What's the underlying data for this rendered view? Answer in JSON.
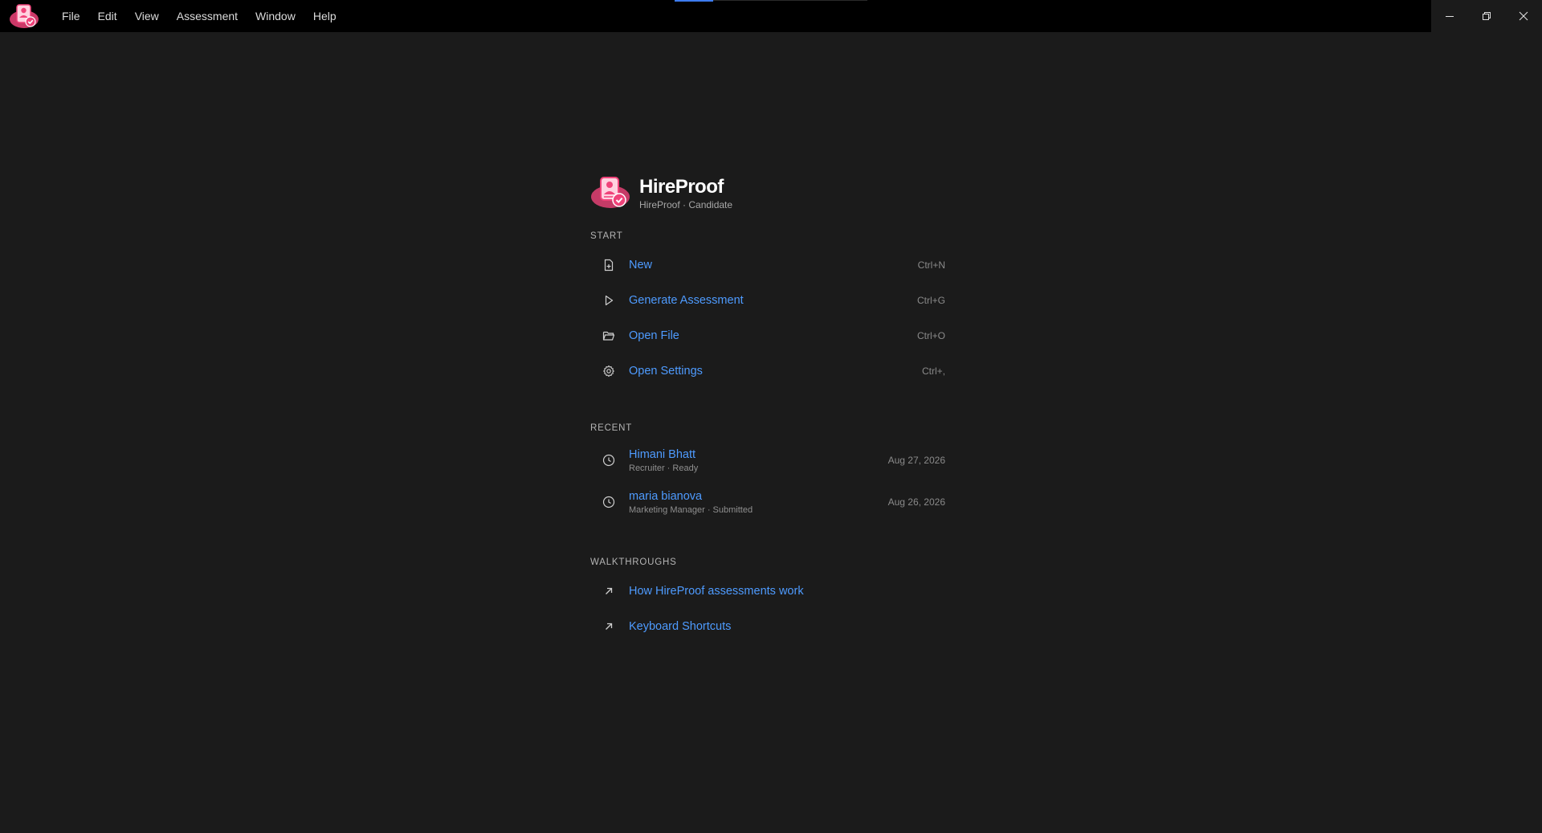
{
  "menubar": {
    "items": [
      "File",
      "Edit",
      "View",
      "Assessment",
      "Window",
      "Help"
    ]
  },
  "brand": {
    "title": "HireProof",
    "subtitle": "HireProof · Candidate",
    "accent": "#f0437a"
  },
  "start": {
    "heading": "START",
    "items": [
      {
        "label": "New",
        "shortcut": "Ctrl+N",
        "icon": "new-file-icon"
      },
      {
        "label": "Generate Assessment",
        "shortcut": "Ctrl+G",
        "icon": "play-icon"
      },
      {
        "label": "Open File",
        "shortcut": "Ctrl+O",
        "icon": "folder-open-icon"
      },
      {
        "label": "Open Settings",
        "shortcut": "Ctrl+,",
        "icon": "gear-icon"
      }
    ]
  },
  "recent": {
    "heading": "RECENT",
    "items": [
      {
        "name": "Himani Bhatt",
        "meta": "Recruiter · Ready",
        "date": "Aug 27, 2026",
        "icon": "clock-icon"
      },
      {
        "name": "maria bianova",
        "meta": "Marketing Manager · Submitted",
        "date": "Aug 26, 2026",
        "icon": "clock-icon"
      }
    ]
  },
  "walkthroughs": {
    "heading": "WALKTHROUGHS",
    "items": [
      {
        "label": "How HireProof assessments work",
        "icon": "arrow-up-right-icon"
      },
      {
        "label": "Keyboard Shortcuts",
        "icon": "arrow-up-right-icon"
      }
    ]
  },
  "colors": {
    "link": "#4e9bff",
    "background": "#1b1b1b",
    "titlebar": "#000000"
  }
}
